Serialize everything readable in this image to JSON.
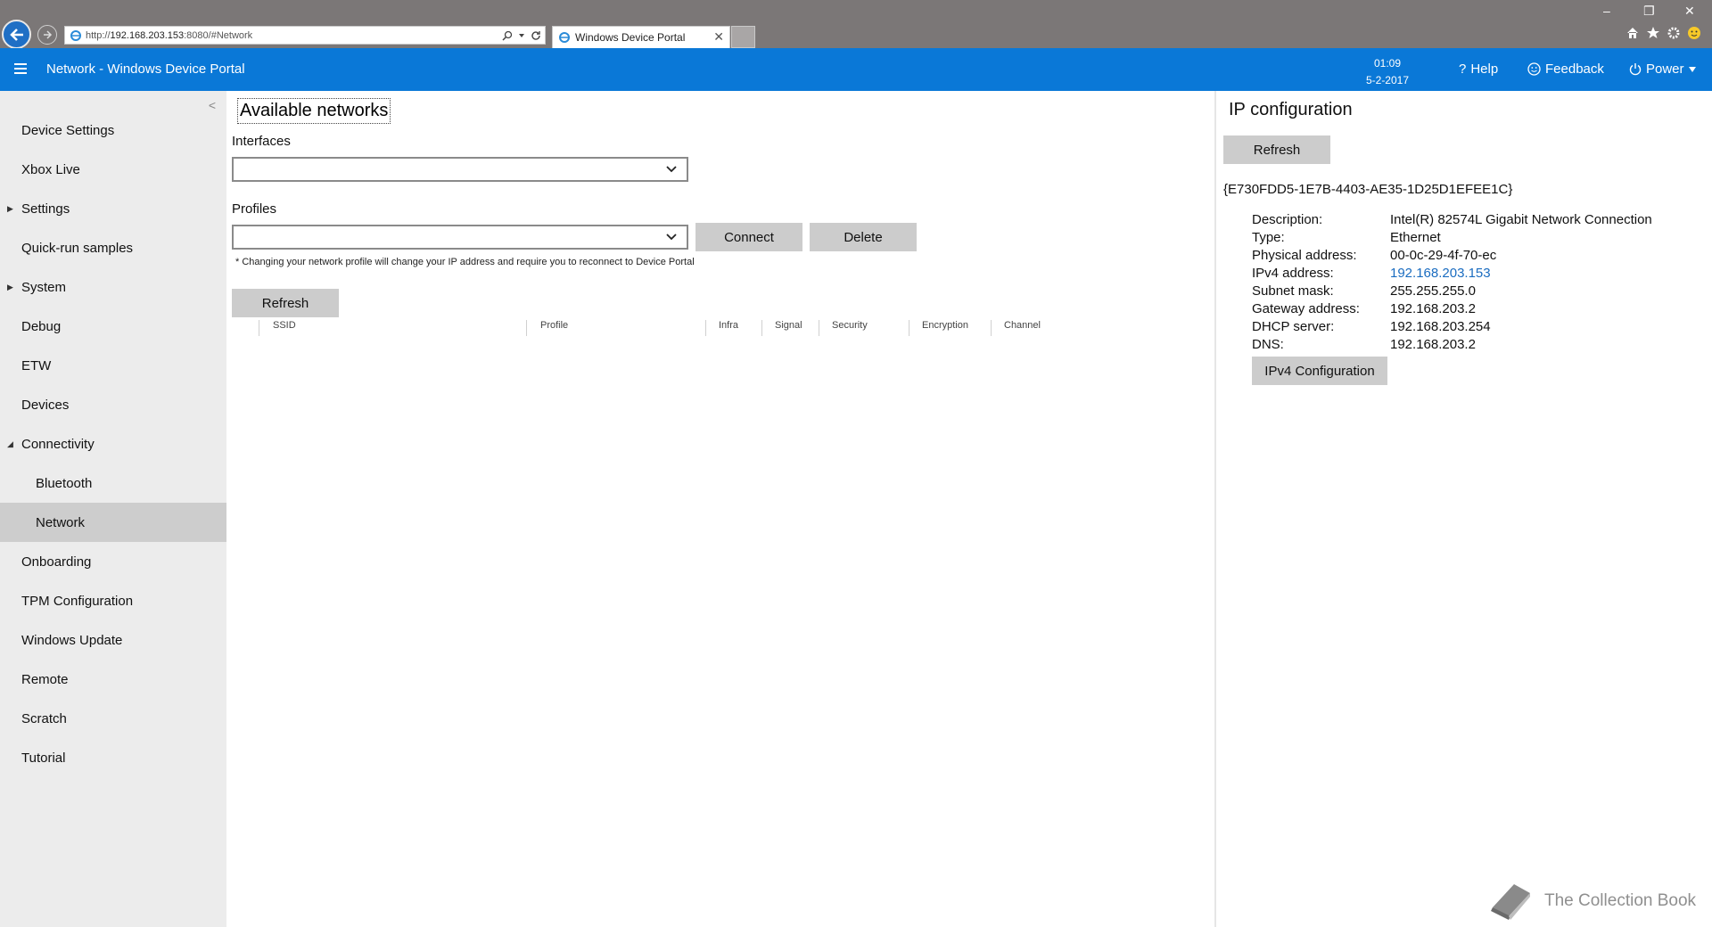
{
  "browser": {
    "url_prefix": "http://",
    "url_host": "192.168.203.153",
    "url_rest": ":8080/#Network",
    "tab_title": "Windows Device Portal",
    "window_controls": [
      "–",
      "❐",
      "✕"
    ]
  },
  "header": {
    "title": "Network - Windows Device Portal",
    "time": "01:09",
    "date": "5-2-2017",
    "help": "Help",
    "feedback": "Feedback",
    "power": "Power"
  },
  "sidebar": {
    "items": [
      {
        "label": "Device Settings"
      },
      {
        "label": "Xbox Live"
      },
      {
        "label": "Settings"
      },
      {
        "label": "Quick-run samples"
      },
      {
        "label": "System"
      },
      {
        "label": "Debug"
      },
      {
        "label": "ETW"
      },
      {
        "label": "Devices"
      },
      {
        "label": "Connectivity"
      },
      {
        "label": "Bluetooth"
      },
      {
        "label": "Network"
      },
      {
        "label": "Onboarding"
      },
      {
        "label": "TPM Configuration"
      },
      {
        "label": "Windows Update"
      },
      {
        "label": "Remote"
      },
      {
        "label": "Scratch"
      },
      {
        "label": "Tutorial"
      }
    ]
  },
  "main": {
    "heading": "Available networks",
    "interfaces_label": "Interfaces",
    "interfaces_value": "",
    "profiles_label": "Profiles",
    "profiles_value": "",
    "connect": "Connect",
    "delete": "Delete",
    "note": "* Changing your network profile will change your IP address and require you to reconnect to Device Portal",
    "refresh": "Refresh",
    "columns": [
      "SSID",
      "Profile",
      "Infra",
      "Signal",
      "Security",
      "Encryption",
      "Channel"
    ]
  },
  "ip": {
    "heading": "IP configuration",
    "refresh": "Refresh",
    "guid": "{E730FDD5-1E7B-4403-AE35-1D25D1EFEE1C}",
    "rows": [
      {
        "k": "Description:",
        "v": "Intel(R) 82574L Gigabit Network Connection"
      },
      {
        "k": "Type:",
        "v": "Ethernet"
      },
      {
        "k": "Physical address:",
        "v": "00-0c-29-4f-70-ec"
      },
      {
        "k": "IPv4 address:",
        "v": "192.168.203.153"
      },
      {
        "k": "Subnet mask:",
        "v": "255.255.255.0"
      },
      {
        "k": "Gateway address:",
        "v": "192.168.203.2"
      },
      {
        "k": "DHCP server:",
        "v": "192.168.203.254"
      },
      {
        "k": "DNS:",
        "v": "192.168.203.2"
      }
    ],
    "ipv4_config": "IPv4 Configuration"
  },
  "brand": {
    "text": "The Collection Book"
  },
  "colors": {
    "accent": "#0a78d7",
    "sidebar_bg": "#ececec",
    "button_bg": "#cccccc",
    "link": "#1a6cc0"
  }
}
